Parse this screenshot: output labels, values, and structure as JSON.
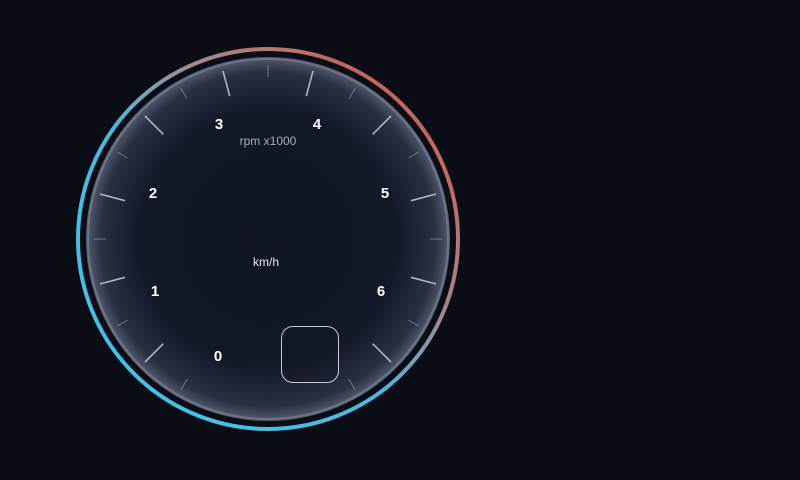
{
  "gauge": {
    "scale_labels": [
      "0",
      "1",
      "2",
      "3",
      "4",
      "5",
      "6"
    ],
    "rpm_unit": "rpm x1000",
    "speed_unit": "km/h",
    "colors": {
      "background": "#0a0d16",
      "dial_face": "#121826",
      "ring_cold": "#3ec6ee",
      "ring_hot": "#d9503a",
      "inner_rim": "#6d7488",
      "tick": "#c9ccd6"
    }
  },
  "gear_indicator": {
    "value": ""
  }
}
